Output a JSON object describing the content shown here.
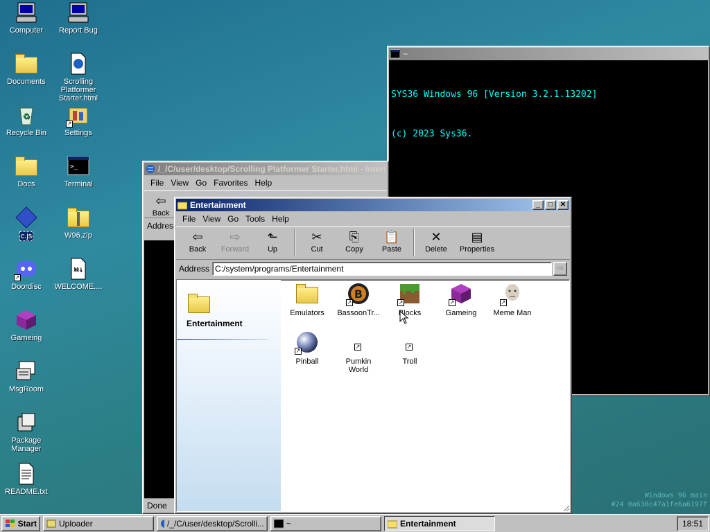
{
  "desktop_icons": [
    {
      "label": "Computer",
      "icon": "computer-icon"
    },
    {
      "label": "Report Bug",
      "icon": "computer-icon"
    },
    {
      "label": "Documents",
      "icon": "folder-icon"
    },
    {
      "label": "Scrolling Platformer Starter.html",
      "icon": "html-file-icon"
    },
    {
      "label": "Recycle Bin",
      "icon": "recycle-bin-icon"
    },
    {
      "label": "Settings",
      "icon": "settings-icon"
    },
    {
      "label": "Docs",
      "icon": "folder-icon"
    },
    {
      "label": "Terminal",
      "icon": "terminal-icon"
    },
    {
      "label": "c.js",
      "icon": "diamond-icon"
    },
    {
      "label": "W96.zip",
      "icon": "zip-folder-icon"
    },
    {
      "label": "Doordisc",
      "icon": "discord-icon"
    },
    {
      "label": "WELCOME....",
      "icon": "markdown-file-icon"
    },
    {
      "label": "Gameing",
      "icon": "cube-icon"
    },
    {
      "label": "MsgRoom",
      "icon": "msgroom-icon"
    },
    {
      "label": "Package Manager",
      "icon": "package-icon"
    },
    {
      "label": "README.txt",
      "icon": "text-file-icon"
    }
  ],
  "terminal": {
    "title": "~",
    "lines": [
      "SYS36 Windows 96 [Version 3.2.1.13202]",
      "(c) 2023 Sys36.",
      "",
      "~ $ "
    ]
  },
  "watermark": {
    "line1": "Windows 96 main",
    "line2": "#24 0a630c47a1fe6a6197f"
  },
  "browser": {
    "title": "/_/C/user/desktop/Scrolling Platformer Starter.html - Intern",
    "menu": [
      "File",
      "View",
      "Go",
      "Favorites",
      "Help"
    ],
    "back_label": "Back",
    "address_label": "Addres",
    "status": "Done"
  },
  "explorer": {
    "title": "Entertainment",
    "menu": [
      "File",
      "View",
      "Go",
      "Tools",
      "Help"
    ],
    "toolbar": [
      {
        "label": "Back",
        "icon": "arrow-left-icon",
        "glyph": "⇦",
        "enabled": true
      },
      {
        "label": "Forward",
        "icon": "arrow-right-icon",
        "glyph": "⇨",
        "enabled": false
      },
      {
        "label": "Up",
        "icon": "up-folder-icon",
        "glyph": "⬑",
        "enabled": true
      },
      {
        "label": "Cut",
        "icon": "scissors-icon",
        "glyph": "✂",
        "enabled": true
      },
      {
        "label": "Copy",
        "icon": "copy-icon",
        "glyph": "⎘",
        "enabled": true
      },
      {
        "label": "Paste",
        "icon": "paste-icon",
        "glyph": "📋",
        "enabled": true
      },
      {
        "label": "Delete",
        "icon": "delete-icon",
        "glyph": "✕",
        "enabled": true
      },
      {
        "label": "Properties",
        "icon": "properties-icon",
        "glyph": "▤",
        "enabled": true
      }
    ],
    "address_label": "Address",
    "address_value": "C:/system/programs/Entertainment",
    "sidebar_title": "Entertainment",
    "items": [
      {
        "label": "Emulators",
        "icon": "folder-icon"
      },
      {
        "label": "BassoonTr...",
        "icon": "bassoon-icon"
      },
      {
        "label": "Blocks",
        "icon": "grass-block-icon"
      },
      {
        "label": "Gameing",
        "icon": "cube-icon"
      },
      {
        "label": "Meme Man",
        "icon": "meme-man-icon"
      },
      {
        "label": "Pinball",
        "icon": "pinball-icon"
      },
      {
        "label": "Pumkin World",
        "icon": "shortcut-icon"
      },
      {
        "label": "Troll",
        "icon": "shortcut-icon"
      }
    ]
  },
  "taskbar": {
    "start_label": "Start",
    "buttons": [
      {
        "label": "Uploader",
        "active": false
      },
      {
        "label": "/_/C/user/desktop/Scrolli...",
        "active": false
      },
      {
        "label": "~",
        "active": false
      },
      {
        "label": "Entertainment",
        "active": true
      }
    ],
    "clock": "18:51"
  },
  "colors": {
    "terminal_text": "#00ffff",
    "title_active": "#0a246a",
    "desktop": "#2a8098"
  }
}
